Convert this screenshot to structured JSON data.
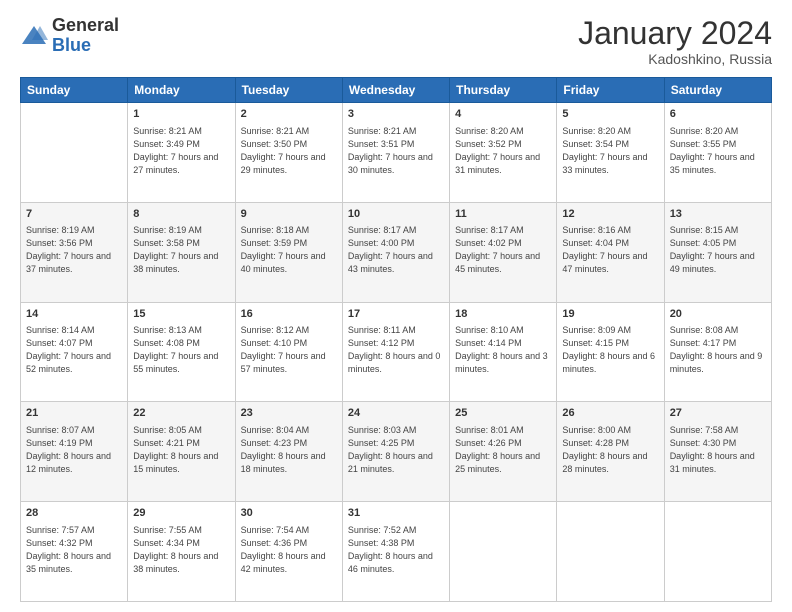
{
  "logo": {
    "general": "General",
    "blue": "Blue"
  },
  "title": {
    "month": "January 2024",
    "location": "Kadoshkino, Russia"
  },
  "weekdays": [
    "Sunday",
    "Monday",
    "Tuesday",
    "Wednesday",
    "Thursday",
    "Friday",
    "Saturday"
  ],
  "weeks": [
    [
      {
        "day": "",
        "sunrise": "",
        "sunset": "",
        "daylight": ""
      },
      {
        "day": "1",
        "sunrise": "Sunrise: 8:21 AM",
        "sunset": "Sunset: 3:49 PM",
        "daylight": "Daylight: 7 hours and 27 minutes."
      },
      {
        "day": "2",
        "sunrise": "Sunrise: 8:21 AM",
        "sunset": "Sunset: 3:50 PM",
        "daylight": "Daylight: 7 hours and 29 minutes."
      },
      {
        "day": "3",
        "sunrise": "Sunrise: 8:21 AM",
        "sunset": "Sunset: 3:51 PM",
        "daylight": "Daylight: 7 hours and 30 minutes."
      },
      {
        "day": "4",
        "sunrise": "Sunrise: 8:20 AM",
        "sunset": "Sunset: 3:52 PM",
        "daylight": "Daylight: 7 hours and 31 minutes."
      },
      {
        "day": "5",
        "sunrise": "Sunrise: 8:20 AM",
        "sunset": "Sunset: 3:54 PM",
        "daylight": "Daylight: 7 hours and 33 minutes."
      },
      {
        "day": "6",
        "sunrise": "Sunrise: 8:20 AM",
        "sunset": "Sunset: 3:55 PM",
        "daylight": "Daylight: 7 hours and 35 minutes."
      }
    ],
    [
      {
        "day": "7",
        "sunrise": "Sunrise: 8:19 AM",
        "sunset": "Sunset: 3:56 PM",
        "daylight": "Daylight: 7 hours and 37 minutes."
      },
      {
        "day": "8",
        "sunrise": "Sunrise: 8:19 AM",
        "sunset": "Sunset: 3:58 PM",
        "daylight": "Daylight: 7 hours and 38 minutes."
      },
      {
        "day": "9",
        "sunrise": "Sunrise: 8:18 AM",
        "sunset": "Sunset: 3:59 PM",
        "daylight": "Daylight: 7 hours and 40 minutes."
      },
      {
        "day": "10",
        "sunrise": "Sunrise: 8:17 AM",
        "sunset": "Sunset: 4:00 PM",
        "daylight": "Daylight: 7 hours and 43 minutes."
      },
      {
        "day": "11",
        "sunrise": "Sunrise: 8:17 AM",
        "sunset": "Sunset: 4:02 PM",
        "daylight": "Daylight: 7 hours and 45 minutes."
      },
      {
        "day": "12",
        "sunrise": "Sunrise: 8:16 AM",
        "sunset": "Sunset: 4:04 PM",
        "daylight": "Daylight: 7 hours and 47 minutes."
      },
      {
        "day": "13",
        "sunrise": "Sunrise: 8:15 AM",
        "sunset": "Sunset: 4:05 PM",
        "daylight": "Daylight: 7 hours and 49 minutes."
      }
    ],
    [
      {
        "day": "14",
        "sunrise": "Sunrise: 8:14 AM",
        "sunset": "Sunset: 4:07 PM",
        "daylight": "Daylight: 7 hours and 52 minutes."
      },
      {
        "day": "15",
        "sunrise": "Sunrise: 8:13 AM",
        "sunset": "Sunset: 4:08 PM",
        "daylight": "Daylight: 7 hours and 55 minutes."
      },
      {
        "day": "16",
        "sunrise": "Sunrise: 8:12 AM",
        "sunset": "Sunset: 4:10 PM",
        "daylight": "Daylight: 7 hours and 57 minutes."
      },
      {
        "day": "17",
        "sunrise": "Sunrise: 8:11 AM",
        "sunset": "Sunset: 4:12 PM",
        "daylight": "Daylight: 8 hours and 0 minutes."
      },
      {
        "day": "18",
        "sunrise": "Sunrise: 8:10 AM",
        "sunset": "Sunset: 4:14 PM",
        "daylight": "Daylight: 8 hours and 3 minutes."
      },
      {
        "day": "19",
        "sunrise": "Sunrise: 8:09 AM",
        "sunset": "Sunset: 4:15 PM",
        "daylight": "Daylight: 8 hours and 6 minutes."
      },
      {
        "day": "20",
        "sunrise": "Sunrise: 8:08 AM",
        "sunset": "Sunset: 4:17 PM",
        "daylight": "Daylight: 8 hours and 9 minutes."
      }
    ],
    [
      {
        "day": "21",
        "sunrise": "Sunrise: 8:07 AM",
        "sunset": "Sunset: 4:19 PM",
        "daylight": "Daylight: 8 hours and 12 minutes."
      },
      {
        "day": "22",
        "sunrise": "Sunrise: 8:05 AM",
        "sunset": "Sunset: 4:21 PM",
        "daylight": "Daylight: 8 hours and 15 minutes."
      },
      {
        "day": "23",
        "sunrise": "Sunrise: 8:04 AM",
        "sunset": "Sunset: 4:23 PM",
        "daylight": "Daylight: 8 hours and 18 minutes."
      },
      {
        "day": "24",
        "sunrise": "Sunrise: 8:03 AM",
        "sunset": "Sunset: 4:25 PM",
        "daylight": "Daylight: 8 hours and 21 minutes."
      },
      {
        "day": "25",
        "sunrise": "Sunrise: 8:01 AM",
        "sunset": "Sunset: 4:26 PM",
        "daylight": "Daylight: 8 hours and 25 minutes."
      },
      {
        "day": "26",
        "sunrise": "Sunrise: 8:00 AM",
        "sunset": "Sunset: 4:28 PM",
        "daylight": "Daylight: 8 hours and 28 minutes."
      },
      {
        "day": "27",
        "sunrise": "Sunrise: 7:58 AM",
        "sunset": "Sunset: 4:30 PM",
        "daylight": "Daylight: 8 hours and 31 minutes."
      }
    ],
    [
      {
        "day": "28",
        "sunrise": "Sunrise: 7:57 AM",
        "sunset": "Sunset: 4:32 PM",
        "daylight": "Daylight: 8 hours and 35 minutes."
      },
      {
        "day": "29",
        "sunrise": "Sunrise: 7:55 AM",
        "sunset": "Sunset: 4:34 PM",
        "daylight": "Daylight: 8 hours and 38 minutes."
      },
      {
        "day": "30",
        "sunrise": "Sunrise: 7:54 AM",
        "sunset": "Sunset: 4:36 PM",
        "daylight": "Daylight: 8 hours and 42 minutes."
      },
      {
        "day": "31",
        "sunrise": "Sunrise: 7:52 AM",
        "sunset": "Sunset: 4:38 PM",
        "daylight": "Daylight: 8 hours and 46 minutes."
      },
      {
        "day": "",
        "sunrise": "",
        "sunset": "",
        "daylight": ""
      },
      {
        "day": "",
        "sunrise": "",
        "sunset": "",
        "daylight": ""
      },
      {
        "day": "",
        "sunrise": "",
        "sunset": "",
        "daylight": ""
      }
    ]
  ]
}
